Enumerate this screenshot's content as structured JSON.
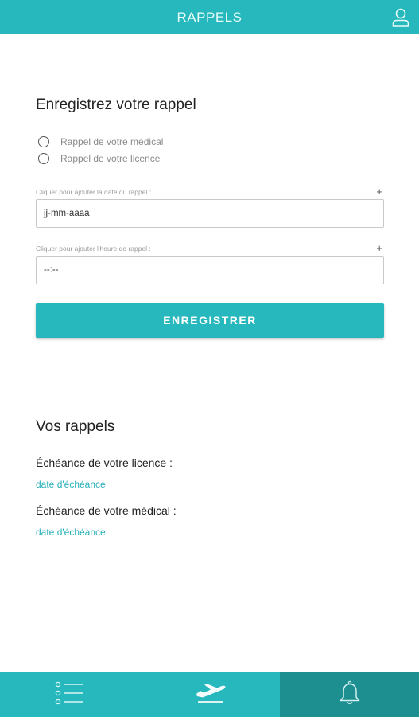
{
  "header": {
    "title": "RAPPELS",
    "icon": "user-icon"
  },
  "form": {
    "title": "Enregistrez votre rappel",
    "radios": [
      {
        "label": "Rappel de votre médical",
        "selected": false
      },
      {
        "label": "Rappel de votre licence",
        "selected": false
      }
    ],
    "date_field": {
      "label": "Cliquer pour ajouter la date du rappel :",
      "plus": "+",
      "value": "jj-mm-aaaa"
    },
    "time_field": {
      "label": "Cliquer pour ajouter l'heure de rappel :",
      "plus": "+",
      "value": "--:--"
    },
    "save_label": "ENREGISTRER"
  },
  "reminders": {
    "title": "Vos rappels",
    "items": [
      {
        "label": "Échéance de votre licence :",
        "value": "date d'échéance"
      },
      {
        "label": "Échéance de votre médical :",
        "value": "date d'échéance"
      }
    ]
  },
  "bottom_nav": {
    "items": [
      {
        "icon": "list-icon",
        "active": false
      },
      {
        "icon": "airplane-icon",
        "active": false
      },
      {
        "icon": "bell-icon",
        "active": true
      }
    ]
  },
  "colors": {
    "accent": "#26b8bc",
    "accent_dark": "#1d8f91",
    "link": "#26b0b8"
  }
}
